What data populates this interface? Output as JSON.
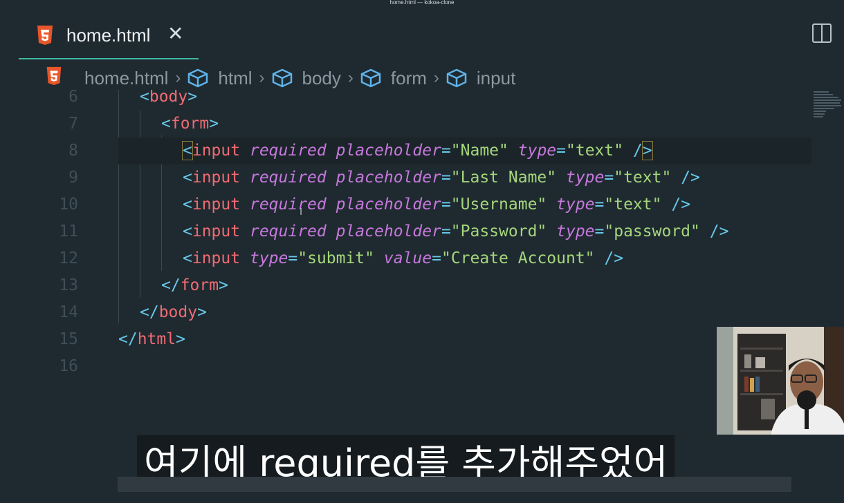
{
  "window": {
    "title": "home.html — kokoa-clone"
  },
  "tab": {
    "title": "home.html",
    "icon": "html5-icon",
    "close_icon": "close-icon"
  },
  "toolbar": {
    "split_icon": "split-editor-icon"
  },
  "breadcrumb": [
    {
      "label": "home.html",
      "icon": "html5-icon"
    },
    {
      "label": "html",
      "icon": "element-icon"
    },
    {
      "label": "body",
      "icon": "element-icon"
    },
    {
      "label": "form",
      "icon": "element-icon"
    },
    {
      "label": "input",
      "icon": "element-icon"
    }
  ],
  "editor": {
    "active_line": 8,
    "lines": [
      {
        "num": "6",
        "text": "<body>"
      },
      {
        "num": "7",
        "text": "<form>"
      },
      {
        "num": "8",
        "text": "<input required placeholder=\"Name\" type=\"text\" />"
      },
      {
        "num": "9",
        "text": "<input required placeholder=\"Last Name\" type=\"text\" />"
      },
      {
        "num": "10",
        "text": "<input required placeholder=\"Username\" type=\"text\" />"
      },
      {
        "num": "11",
        "text": "<input required placeholder=\"Password\" type=\"password\" />"
      },
      {
        "num": "12",
        "text": "<input type=\"submit\" value=\"Create Account\" />"
      },
      {
        "num": "13",
        "text": "</form>"
      },
      {
        "num": "14",
        "text": "</body>"
      },
      {
        "num": "15",
        "text": "</html>"
      },
      {
        "num": "16",
        "text": ""
      }
    ]
  },
  "subtitle": {
    "text": "여기에 required를 추가해주었어"
  },
  "colors": {
    "background": "#1f2a30",
    "tab_underline": "#3fb8a3",
    "tag": "#ef6b73",
    "attr": "#c678dd",
    "string": "#a5d67c",
    "punct": "#67c9ea"
  }
}
